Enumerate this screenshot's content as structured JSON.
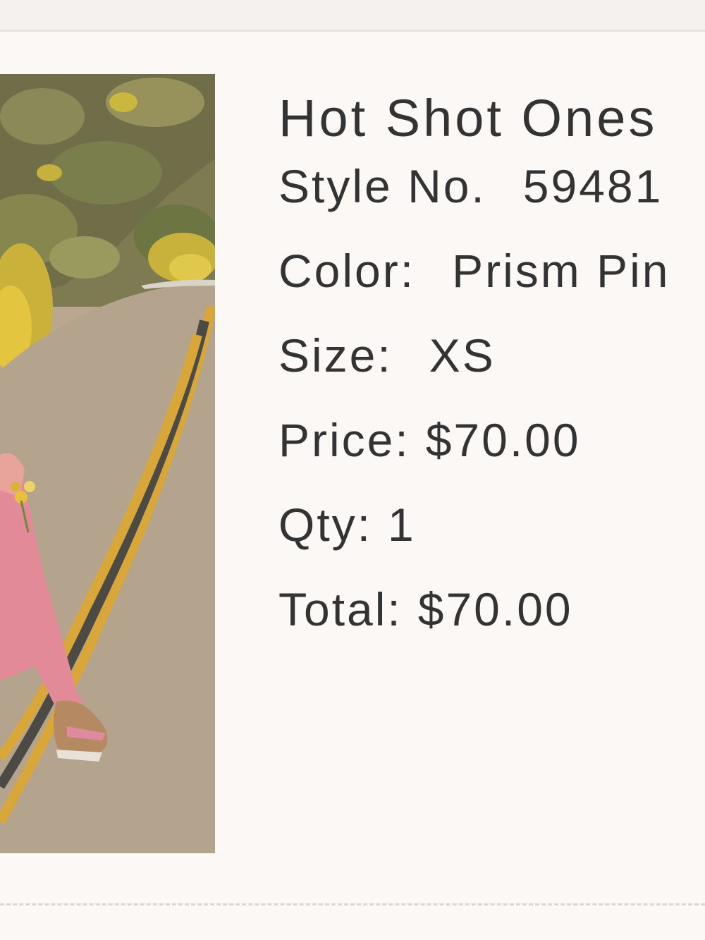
{
  "product": {
    "name": "Hot Shot Ones",
    "style_label": "Style No.",
    "style_value": "59481",
    "color_label": "Color:",
    "color_value": "Prism Pin",
    "size_label": "Size:",
    "size_value": "XS",
    "price_label": "Price:",
    "price_value": "$70.00",
    "qty_label": "Qty:",
    "qty_value": "1",
    "total_label": "Total:",
    "total_value": "$70.00"
  },
  "image": {
    "subject": "model in pink onesie walking on road"
  },
  "colors": {
    "background": "#fcf8f6",
    "text": "#333333",
    "divider": "#dcd6d1"
  }
}
